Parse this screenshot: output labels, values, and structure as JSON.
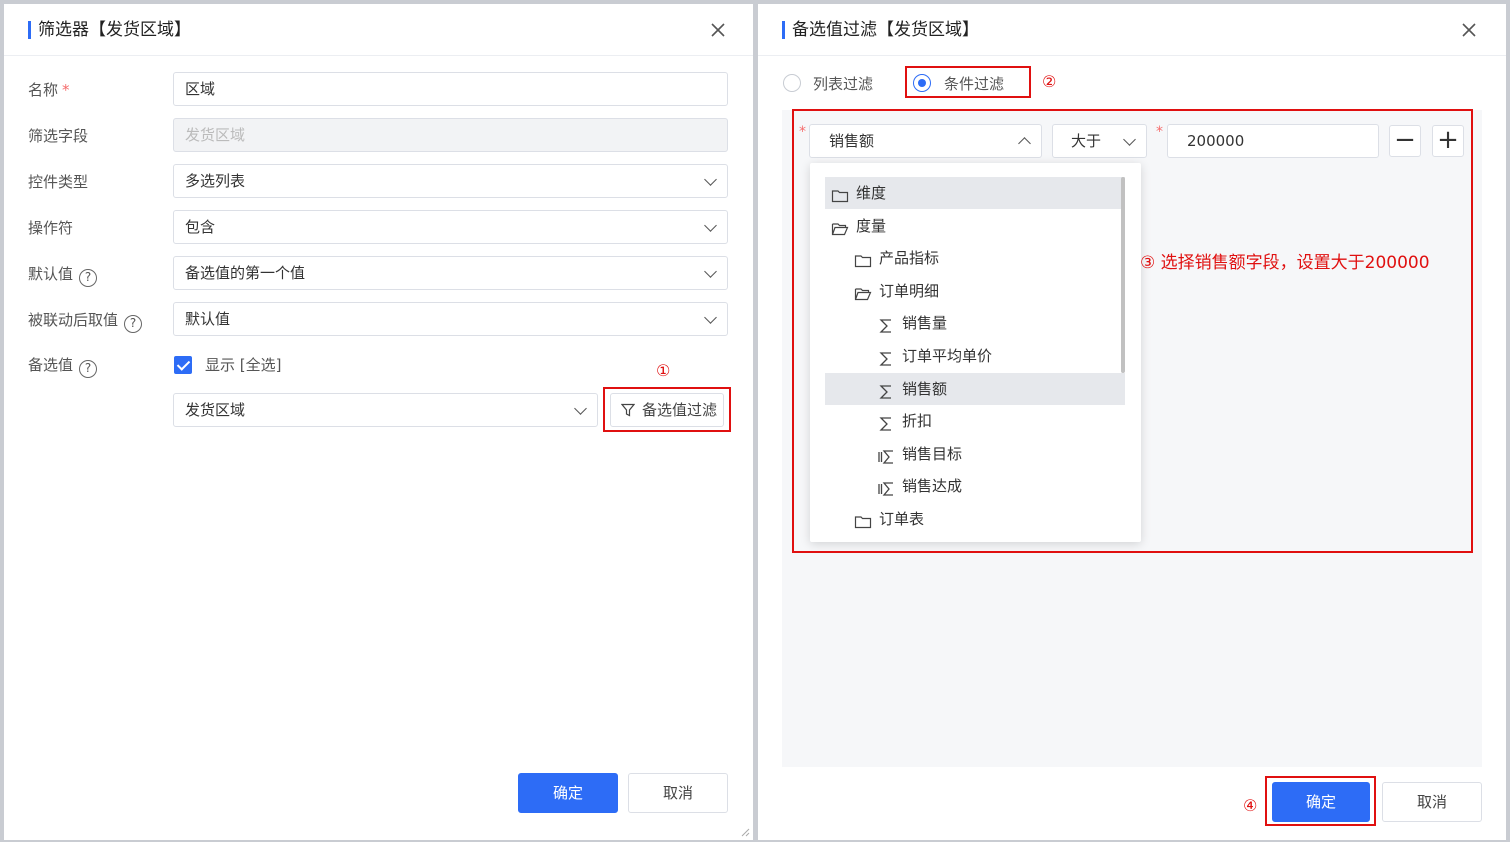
{
  "left_dialog": {
    "title": "筛选器【发货区域】",
    "fields": {
      "name_label": "名称",
      "name_required": "*",
      "name_value": "区域",
      "field_label": "筛选字段",
      "field_value": "发货区域",
      "control_label": "控件类型",
      "control_value": "多选列表",
      "operator_label": "操作符",
      "operator_value": "包含",
      "default_label": "默认值",
      "default_value": "备选值的第一个值",
      "linked_label": "被联动后取值",
      "linked_value": "默认值",
      "options_label": "备选值",
      "show_all_label": "显示 [全选]",
      "options_source": "发货区域",
      "filter_button": "备选值过滤"
    },
    "ok_button": "确定",
    "cancel_button": "取消"
  },
  "right_dialog": {
    "title": "备选值过滤【发货区域】",
    "radios": {
      "list_filter": "列表过滤",
      "condition_filter": "条件过滤",
      "selected": "条件过滤"
    },
    "condition": {
      "field": "销售额",
      "operator": "大于",
      "value": "200000",
      "minus": "−",
      "plus": "+"
    },
    "tree": [
      {
        "label": "维度",
        "type": "folder",
        "highlight": true
      },
      {
        "label": "度量",
        "type": "folder-open"
      },
      {
        "label": "产品指标",
        "type": "folder"
      },
      {
        "label": "订单明细",
        "type": "folder-open"
      },
      {
        "label": "销售量",
        "type": "sigma"
      },
      {
        "label": "订单平均单价",
        "type": "sigma"
      },
      {
        "label": "销售额",
        "type": "sigma",
        "highlight": true
      },
      {
        "label": "折扣",
        "type": "sigma"
      },
      {
        "label": "销售目标",
        "type": "sigma-calc"
      },
      {
        "label": "销售达成",
        "type": "sigma-calc"
      },
      {
        "label": "订单表",
        "type": "folder"
      }
    ],
    "ok_button": "确定",
    "cancel_button": "取消"
  },
  "annotations": {
    "a1": "①",
    "a2": "②",
    "a3": "③  选择销售额字段，设置大于200000",
    "a4": "④"
  },
  "help_icon_glyph": "?",
  "colors": {
    "primary": "#2d6cf6",
    "annotation": "#e01010",
    "required": "#f56c6c"
  }
}
